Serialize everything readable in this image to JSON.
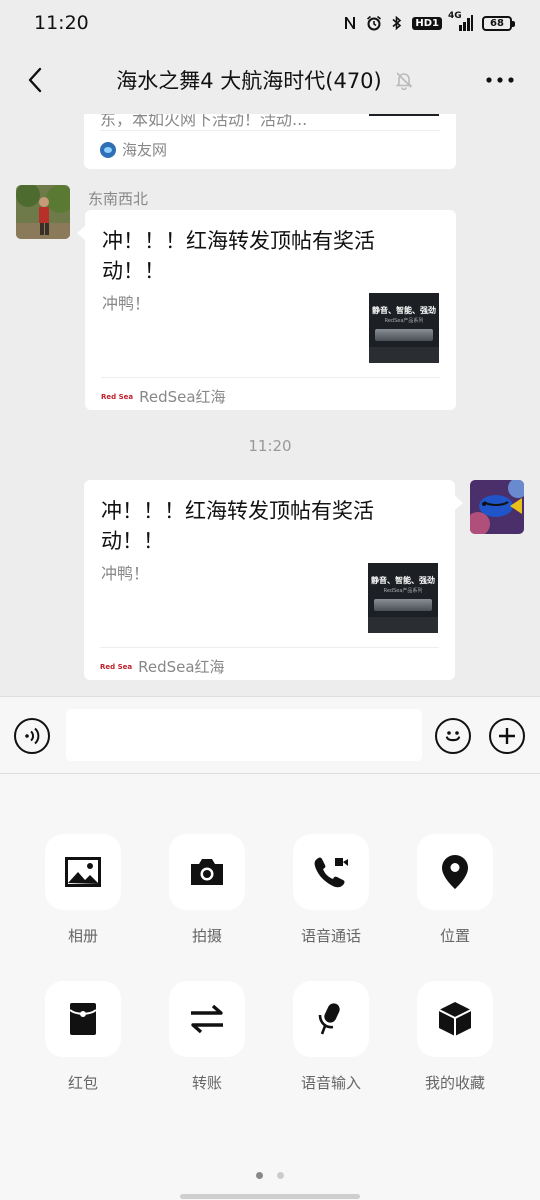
{
  "status_bar": {
    "time": "11:20",
    "network": "4G",
    "hd": "HD1",
    "battery": "68"
  },
  "nav": {
    "title": "海水之舞4 大航海时代(470)"
  },
  "chat": {
    "partial_card": {
      "text": "东，本如火网下活动！活动...",
      "source": "海友网"
    },
    "incoming": {
      "sender": "东南西北",
      "title": "冲！！！红海转发顶帖有奖活动！！",
      "desc": "冲鸭！",
      "thumb_text": "静音、智能、强劲",
      "thumb_sub": "RedSea产品系列",
      "source": "RedSea红海",
      "source_logo": "Red Sea"
    },
    "timestamp": "11:20",
    "outgoing": {
      "title": "冲！！！红海转发顶帖有奖活动！！",
      "desc": "冲鸭！",
      "thumb_text": "静音、智能、强劲",
      "thumb_sub": "RedSea产品系列",
      "source": "RedSea红海",
      "source_logo": "Red Sea"
    }
  },
  "input": {
    "value": "",
    "placeholder": ""
  },
  "panel": {
    "tools": [
      {
        "label": "相册",
        "icon": "photo-icon"
      },
      {
        "label": "拍摄",
        "icon": "camera-icon"
      },
      {
        "label": "语音通话",
        "icon": "voice-call-icon"
      },
      {
        "label": "位置",
        "icon": "location-icon"
      },
      {
        "label": "红包",
        "icon": "red-packet-icon"
      },
      {
        "label": "转账",
        "icon": "transfer-icon"
      },
      {
        "label": "语音输入",
        "icon": "microphone-icon"
      },
      {
        "label": "我的收藏",
        "icon": "favorites-icon"
      }
    ],
    "page_count": 2,
    "current_page": 1
  },
  "colors": {
    "background": "#ededed",
    "panel": "#f7f7f7",
    "bubble": "#ffffff",
    "icon": "#111111"
  }
}
